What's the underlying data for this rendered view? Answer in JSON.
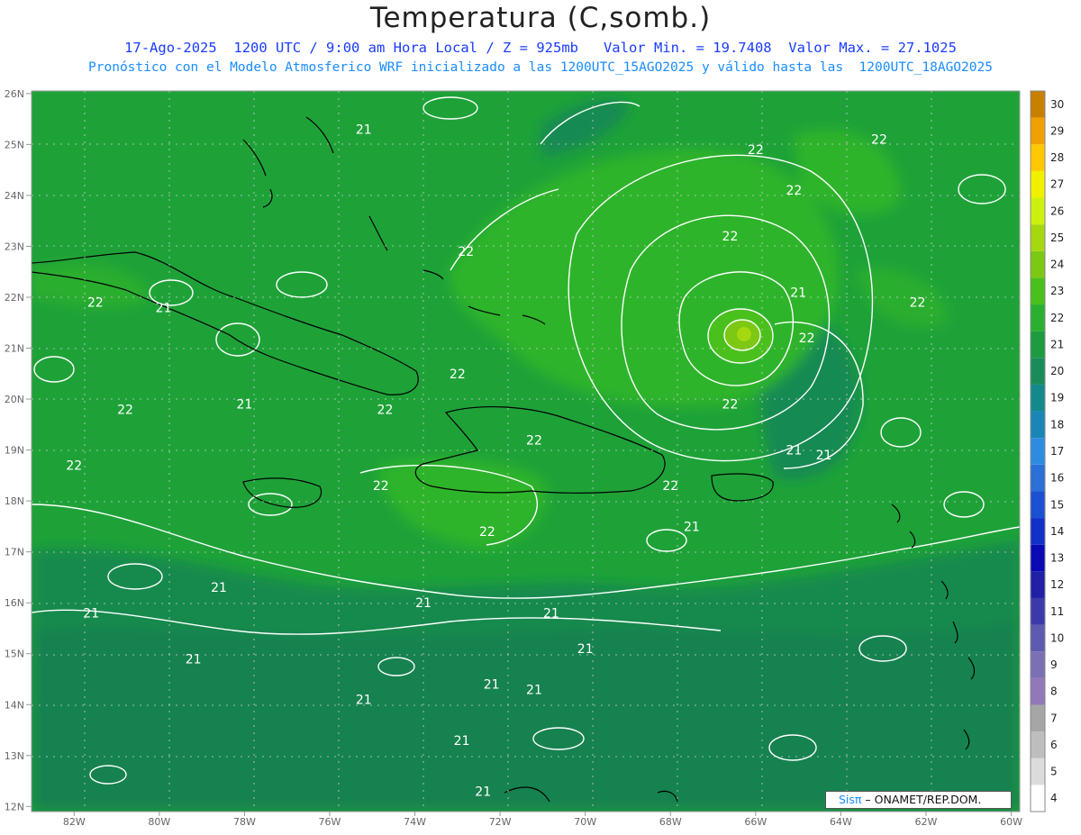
{
  "header": {
    "title": "Temperatura (C,somb.)",
    "line1": "17-Ago-2025  1200 UTC / 9:00 am Hora Local / Z = 925mb   Valor Min. = 19.7408  Valor Max. = 27.1025",
    "line2": "Pronóstico con el Modelo Atmosferico WRF inicializado a las 1200UTC_15AGO2025 y válido hasta las  1200UTC_18AGO2025"
  },
  "axes": {
    "lat_labels": [
      "26N",
      "25N",
      "24N",
      "23N",
      "22N",
      "21N",
      "20N",
      "19N",
      "18N",
      "17N",
      "16N",
      "15N",
      "14N",
      "13N",
      "12N"
    ],
    "lon_labels": [
      "82W",
      "80W",
      "78W",
      "76W",
      "74W",
      "72W",
      "70W",
      "68W",
      "66W",
      "64W",
      "62W",
      "60W"
    ]
  },
  "contour_labels": [
    {
      "text": "21",
      "lon": -79.9,
      "lat": 21.8
    },
    {
      "text": "22",
      "lon": -81.5,
      "lat": 21.9
    },
    {
      "text": "21",
      "lon": -75.2,
      "lat": 25.3
    },
    {
      "text": "21",
      "lon": -78.0,
      "lat": 19.9
    },
    {
      "text": "22",
      "lon": -80.8,
      "lat": 19.8
    },
    {
      "text": "22",
      "lon": -82.0,
      "lat": 18.7
    },
    {
      "text": "22",
      "lon": -73.0,
      "lat": 20.5
    },
    {
      "text": "22",
      "lon": -74.7,
      "lat": 19.8
    },
    {
      "text": "22",
      "lon": -71.2,
      "lat": 19.2
    },
    {
      "text": "22",
      "lon": -74.8,
      "lat": 18.3
    },
    {
      "text": "22",
      "lon": -72.3,
      "lat": 17.4
    },
    {
      "text": "22",
      "lon": -68.0,
      "lat": 18.3
    },
    {
      "text": "22",
      "lon": -72.8,
      "lat": 22.9
    },
    {
      "text": "22",
      "lon": -66.0,
      "lat": 24.9
    },
    {
      "text": "22",
      "lon": -65.1,
      "lat": 24.1
    },
    {
      "text": "22",
      "lon": -63.1,
      "lat": 25.1
    },
    {
      "text": "22",
      "lon": -66.6,
      "lat": 23.2
    },
    {
      "text": "21",
      "lon": -65.0,
      "lat": 22.1
    },
    {
      "text": "22",
      "lon": -62.2,
      "lat": 21.9
    },
    {
      "text": "22",
      "lon": -64.8,
      "lat": 21.2
    },
    {
      "text": "22",
      "lon": -66.6,
      "lat": 19.9
    },
    {
      "text": "21",
      "lon": -65.1,
      "lat": 19.0
    },
    {
      "text": "21",
      "lon": -64.4,
      "lat": 18.9
    },
    {
      "text": "21",
      "lon": -67.5,
      "lat": 17.5
    },
    {
      "text": "21",
      "lon": -78.6,
      "lat": 16.3
    },
    {
      "text": "21",
      "lon": -81.6,
      "lat": 15.8
    },
    {
      "text": "21",
      "lon": -79.2,
      "lat": 14.9
    },
    {
      "text": "21",
      "lon": -73.8,
      "lat": 16.0
    },
    {
      "text": "21",
      "lon": -70.8,
      "lat": 15.8
    },
    {
      "text": "21",
      "lon": -70.0,
      "lat": 15.1
    },
    {
      "text": "21",
      "lon": -72.2,
      "lat": 14.4
    },
    {
      "text": "21",
      "lon": -71.2,
      "lat": 14.3
    },
    {
      "text": "21",
      "lon": -75.2,
      "lat": 14.1
    },
    {
      "text": "21",
      "lon": -72.9,
      "lat": 13.3
    },
    {
      "text": "21",
      "lon": -72.4,
      "lat": 12.3
    }
  ],
  "colorbar": {
    "levels": [
      4,
      5,
      6,
      7,
      8,
      9,
      10,
      11,
      12,
      13,
      14,
      15,
      16,
      17,
      18,
      19,
      20,
      21,
      22,
      23,
      24,
      25,
      26,
      27,
      28,
      29,
      30
    ],
    "colors": [
      "#ffffff",
      "#dcdcdc",
      "#bebebe",
      "#a6a6a6",
      "#9178b8",
      "#7c70b4",
      "#5d5ab0",
      "#3c3aaa",
      "#2020a6",
      "#0a0ab4",
      "#1030c8",
      "#1c50d2",
      "#2a70d6",
      "#2e8ce0",
      "#1a86b8",
      "#128a8c",
      "#1a8c5a",
      "#1e9a40",
      "#2ab030",
      "#4ac01c",
      "#7cc814",
      "#a6d810",
      "#ccf010",
      "#f0f000",
      "#ffc800",
      "#f0a000",
      "#c88000"
    ]
  },
  "credit": {
    "brand": "Sisπ",
    "text": " – ONAMET/REP.DOM."
  }
}
